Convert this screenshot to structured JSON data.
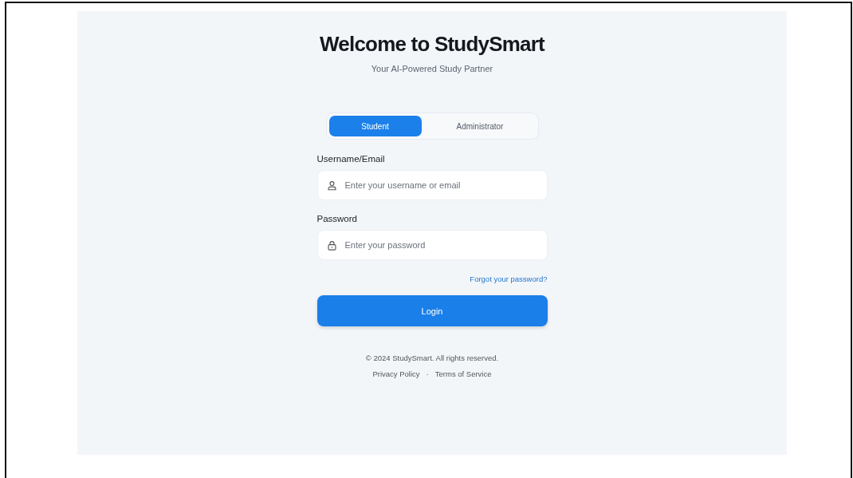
{
  "title": "Welcome to StudySmart",
  "subtitle": "Your AI-Powered Study Partner",
  "tabs": [
    {
      "label": "Student",
      "selected": true
    },
    {
      "label": "Administrator",
      "selected": false
    }
  ],
  "fields": [
    {
      "label": "Username/Email",
      "placeholder": "Enter your username or email",
      "kind": "user"
    },
    {
      "label": "Password",
      "placeholder": "Enter your password",
      "kind": "password"
    }
  ],
  "forgot_link": "Forgot your password?",
  "login_button": "Login",
  "footer": {
    "copyright": "© 2024 StudySmart. All rights reserved.",
    "links": [
      "Privacy Policy",
      "Terms of Service"
    ],
    "separator": "·"
  }
}
